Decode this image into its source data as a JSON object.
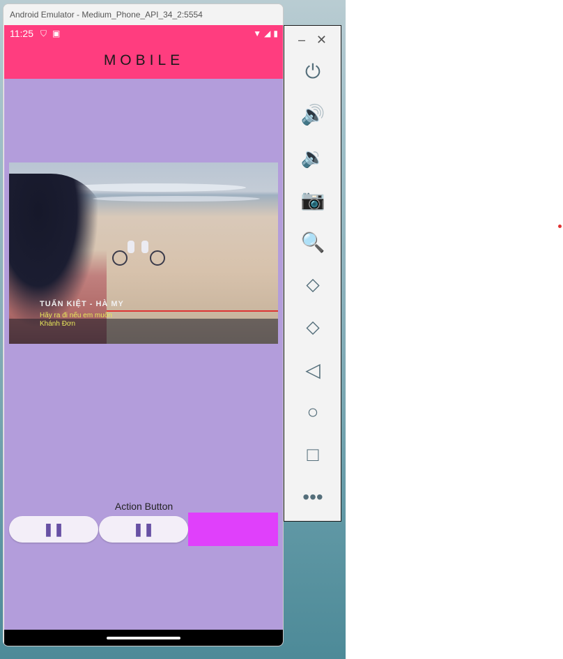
{
  "window": {
    "title": "Android Emulator - Medium_Phone_API_34_2:5554"
  },
  "status_bar": {
    "time": "11:25"
  },
  "app_bar": {
    "title": "MOBILE"
  },
  "video": {
    "caption_title": "TUẤN KIỆT - HÀ MY",
    "caption_lines": [
      "Hãy ra đi nếu em muốn",
      "Khánh Đơn"
    ]
  },
  "controls": {
    "label": "Action Button",
    "button1_icon": "pause-icon",
    "button2_icon": "pause-icon",
    "accent_box_color": "#e040fb"
  },
  "toolbar": {
    "items": [
      "minimize-icon",
      "close-icon",
      "power-icon",
      "volume-up-icon",
      "volume-down-icon",
      "camera-icon",
      "zoom-icon",
      "rotate-left-icon",
      "rotate-right-icon",
      "back-icon",
      "home-icon",
      "overview-icon",
      "more-icon"
    ]
  },
  "colors": {
    "app_bar": "#ff3d7f",
    "background": "#b39ddb",
    "button_icon": "#6750a4",
    "toolbar_icon": "#546e7a"
  }
}
